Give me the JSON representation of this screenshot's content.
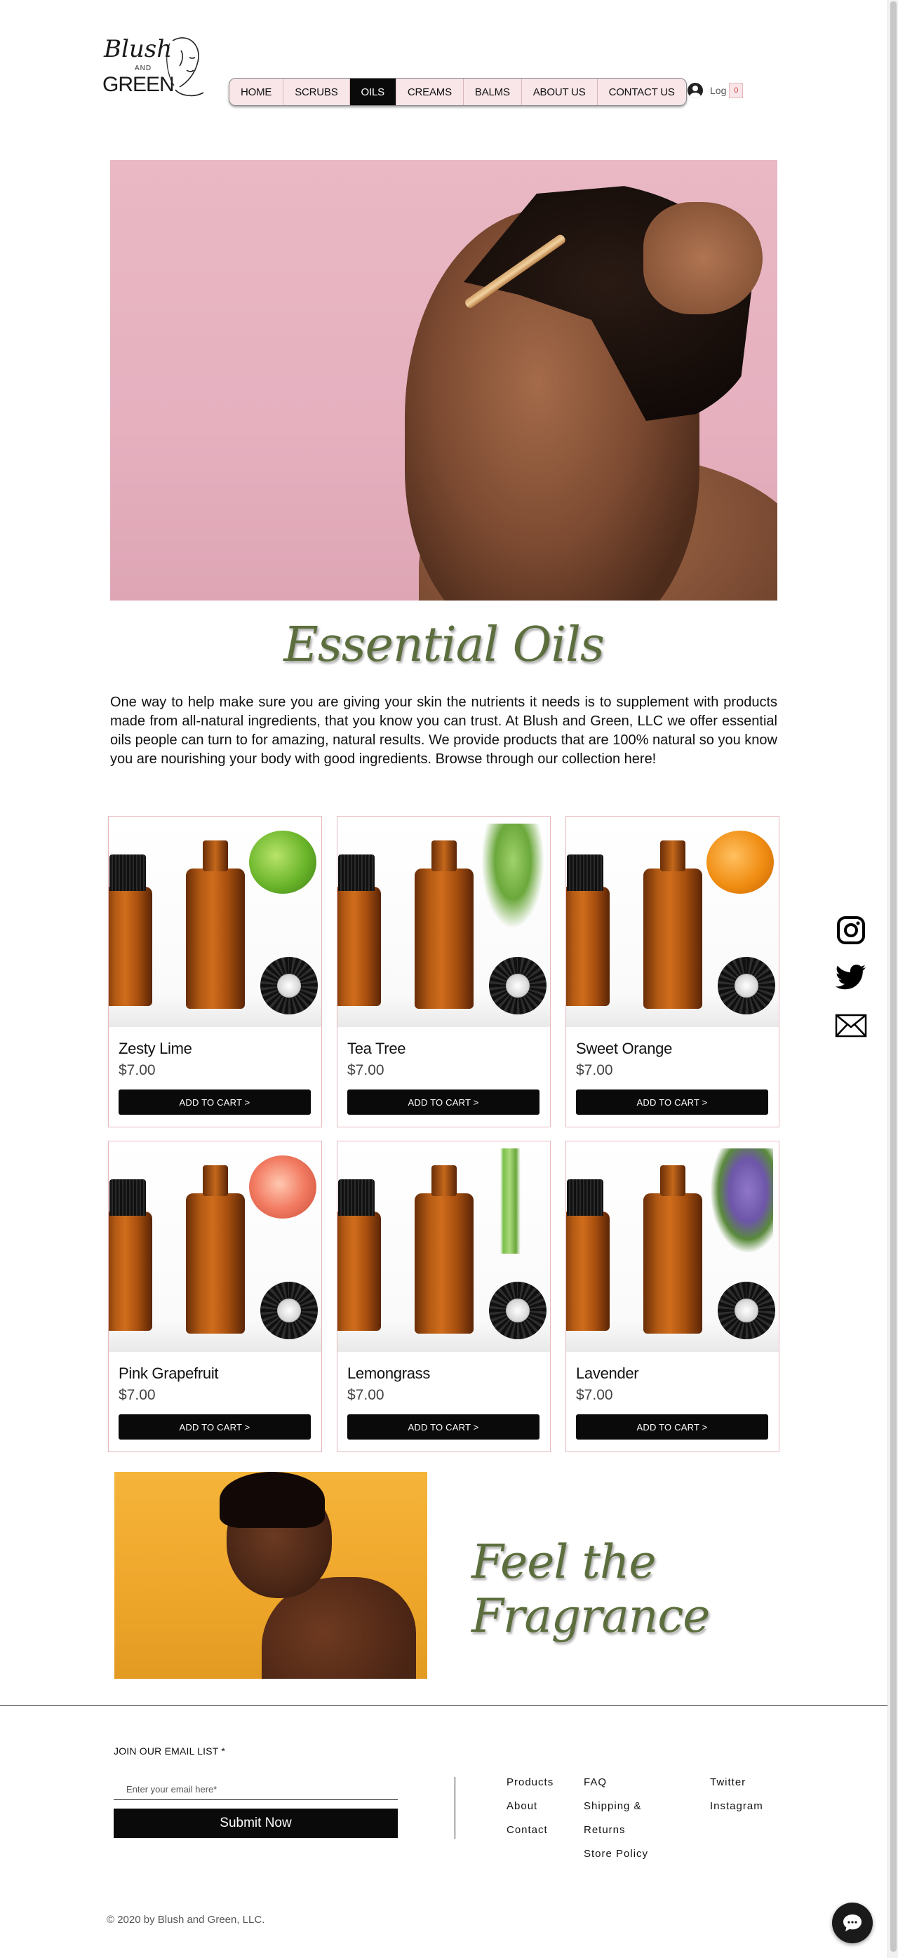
{
  "logo": {
    "line1": "Blush",
    "line2": "AND",
    "line3": "GREEN"
  },
  "nav": {
    "items": [
      {
        "label": "HOME",
        "active": false
      },
      {
        "label": "SCRUBS",
        "active": false
      },
      {
        "label": "OILS",
        "active": true
      },
      {
        "label": "CREAMS",
        "active": false
      },
      {
        "label": "BALMS",
        "active": false
      },
      {
        "label": "ABOUT US",
        "active": false
      },
      {
        "label": "CONTACT US",
        "active": false
      }
    ]
  },
  "account": {
    "login_label": "Log",
    "cart_count": "0"
  },
  "section": {
    "title": "Essential Oils",
    "intro": "One way to help make sure you are giving your skin the nutrients it needs is to supplement with products made from all-natural ingredients, that you know you can trust. At Blush and Green, LLC we offer essential oils people can turn to for amazing, natural results. We provide products that are 100% natural so you know you are nourishing your body with good ingredients. Browse through our collection here!"
  },
  "products": [
    {
      "name": "Zesty Lime",
      "price": "$7.00",
      "button": "ADD TO CART >"
    },
    {
      "name": "Tea Tree",
      "price": "$7.00",
      "button": "ADD TO CART >"
    },
    {
      "name": "Sweet Orange",
      "price": "$7.00",
      "button": "ADD TO CART >"
    },
    {
      "name": "Pink Grapefruit",
      "price": "$7.00",
      "button": "ADD TO CART >"
    },
    {
      "name": "Lemongrass",
      "price": "$7.00",
      "button": "ADD TO CART >"
    },
    {
      "name": "Lavender",
      "price": "$7.00",
      "button": "ADD TO CART >"
    }
  ],
  "social": [
    "instagram-icon",
    "twitter-icon",
    "mail-icon"
  ],
  "feature": {
    "title": "Feel the Fragrance"
  },
  "footer": {
    "email_label": "JOIN OUR EMAIL LIST *",
    "email_placeholder": "Enter your email here*",
    "submit_label": "Submit Now",
    "col1": [
      "Products",
      "About",
      "Contact"
    ],
    "col2": [
      "FAQ",
      "Shipping &",
      "Returns",
      "Store Policy"
    ],
    "col3": [
      "Twitter",
      "Instagram"
    ],
    "copyright": "© 2020 by Blush and Green, LLC."
  },
  "colors": {
    "accent_pink": "#f8e6e8",
    "script_green": "#5c6e3d",
    "button_black": "#0a0a0a"
  }
}
